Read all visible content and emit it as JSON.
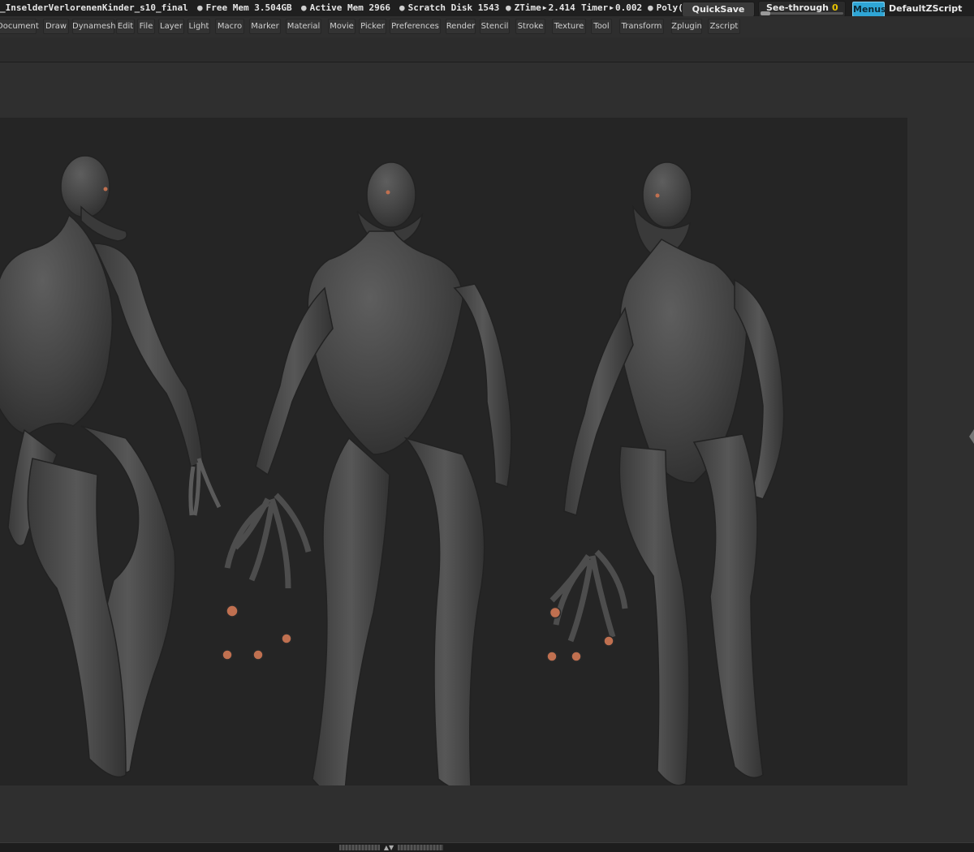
{
  "titlebar": {
    "doc_name": "_InselderVerlorenenKinder_s10_final",
    "free_mem": "Free Mem 3.504GB",
    "active_mem": "Active Mem 2966",
    "scratch_disk": "Scratch Disk 1543",
    "ztime_label": "ZTime",
    "ztime_value": "2.414",
    "timer_label": "Timer",
    "timer_value": "0.002",
    "poly_label": "Poly("
  },
  "quicksave": {
    "label": "QuickSave"
  },
  "seethrough": {
    "label": "See-through",
    "value": "0"
  },
  "menus_button": {
    "label": "Menus"
  },
  "script_name": "DefaultZScript",
  "menubar": {
    "items": [
      "Document",
      "Draw",
      "Dynamesh",
      "Edit",
      "File",
      "Layer",
      "Light",
      "Macro",
      "Marker",
      "Material",
      "Movie",
      "Picker",
      "Preferences",
      "Render",
      "Stencil",
      "Stroke",
      "Texture",
      "Tool",
      "Transform",
      "Zplugin",
      "Zscript"
    ]
  },
  "icons": {
    "right_handle": "chevron-left-icon",
    "bottom_grip": "collapse-arrow-icon"
  },
  "colors": {
    "accent": "#2fa6d6",
    "see_through_value": "#e8c400",
    "model_clay": "#4a4a4a",
    "model_eye": "#c07050"
  }
}
